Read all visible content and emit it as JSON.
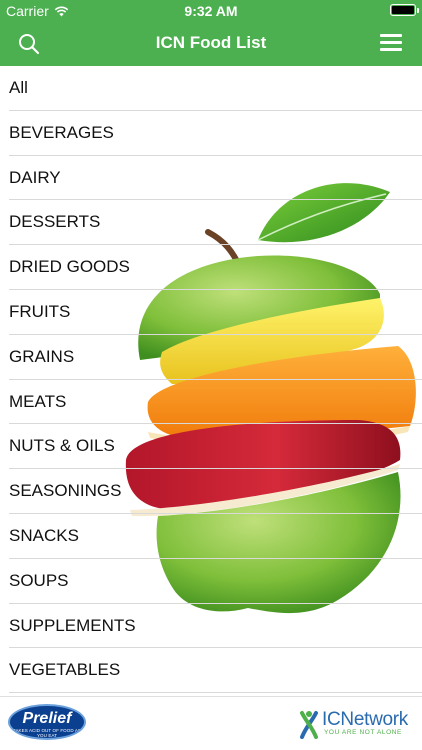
{
  "status_bar": {
    "carrier": "Carrier",
    "time": "9:32 AM",
    "wifi_icon": "wifi-icon",
    "battery_icon": "battery-icon"
  },
  "nav": {
    "title": "ICN Food List",
    "search_icon": "search-icon",
    "menu_icon": "hamburger-menu-icon"
  },
  "categories": [
    "All",
    "BEVERAGES",
    "DAIRY",
    "DESSERTS",
    "DRIED GOODS",
    "FRUITS",
    "GRAINS",
    "MEATS",
    "NUTS & OILS",
    "SEASONINGS",
    "SNACKS",
    "SOUPS",
    "SUPPLEMENTS",
    "VEGETABLES"
  ],
  "footer": {
    "prelief": {
      "name": "Prelief",
      "tagline": "TAKES ACID OUT OF FOOD AS YOU EAT"
    },
    "icnetwork": {
      "name": "ICNetwork",
      "tagline": "YOU ARE NOT ALONE"
    }
  },
  "colors": {
    "nav_green": "#4caf50",
    "prelief_blue": "#0b3f8f",
    "icn_blue": "#2a6bb0",
    "icn_green": "#4db04a"
  }
}
